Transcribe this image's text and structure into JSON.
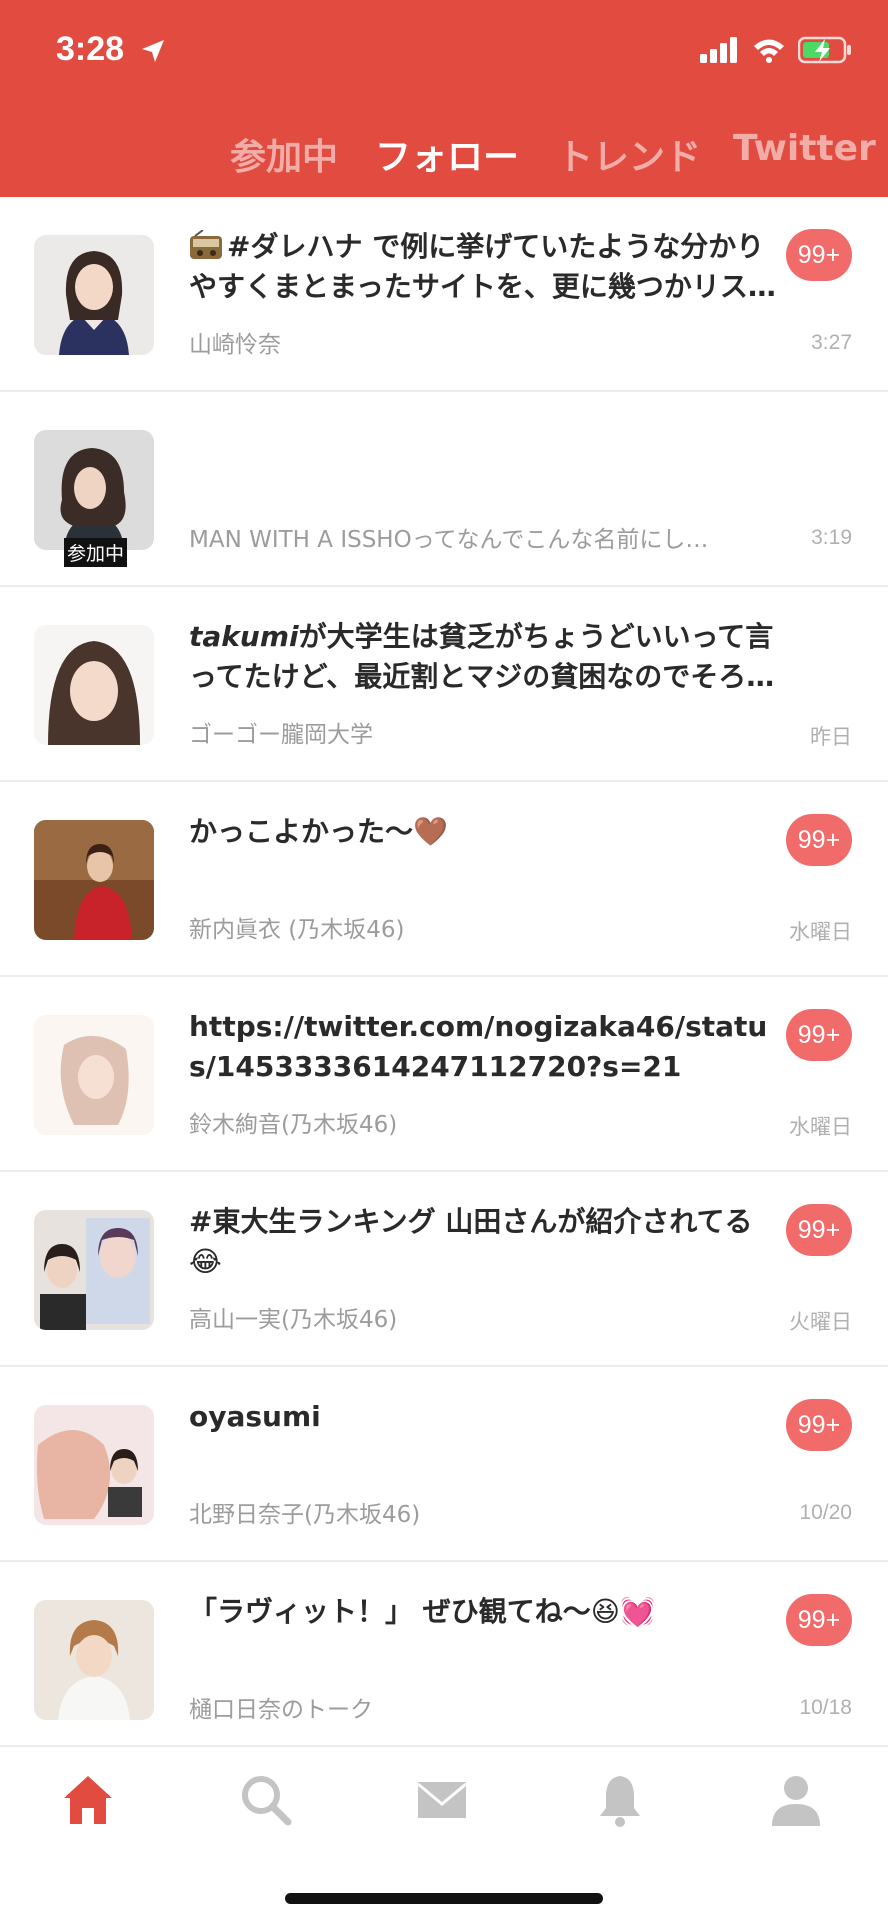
{
  "status_bar": {
    "time": "3:28"
  },
  "header": {
    "tabs": [
      {
        "label": "参加中"
      },
      {
        "label": "フォロー"
      },
      {
        "label": "トレンド"
      },
      {
        "label": "Twitter"
      }
    ],
    "active_tab": "フォロー"
  },
  "rows": [
    {
      "msg_icon": "radio-emoji",
      "message": "#ダレハナ で例に挙げていたような分かりやすくまとまったサイトを、更に幾つかリス…",
      "name": "山崎怜奈",
      "time": "3:27",
      "badge": "99+"
    },
    {
      "message": "",
      "name": "MAN WITH A ISSHOってなんでこんな名前にし…",
      "time": "3:19",
      "joined_label": "参加中"
    },
    {
      "message_italic": "takumi",
      "message": "が大学生は貧乏がちょうどいいって言ってたけど、最近割とマジの貧困なのでそろ…",
      "name": "ゴーゴー朧岡大学",
      "time": "昨日"
    },
    {
      "message": "かっこよかった〜🤎",
      "name": "新内眞衣 (乃木坂46)",
      "time": "水曜日",
      "badge": "99+"
    },
    {
      "message": "https://twitter.com/nogizaka46/status/1453333614247112720?s=21",
      "name": "鈴木絢音(乃木坂46)",
      "time": "水曜日",
      "badge": "99+"
    },
    {
      "message": "#東大生ランキング 山田さんが紹介されてる😂",
      "name": "高山一実(乃木坂46)",
      "time": "火曜日",
      "badge": "99+"
    },
    {
      "message": "oyasumi",
      "name": "北野日奈子(乃木坂46)",
      "time": "10/20",
      "badge": "99+"
    },
    {
      "message": "「ラヴィット！」 ぜひ観てね〜😆💓",
      "name": "樋口日奈のトーク",
      "time": "10/18",
      "badge": "99+"
    }
  ],
  "tab_bar": {
    "items": [
      {
        "icon": "home-icon",
        "active": true
      },
      {
        "icon": "search-icon"
      },
      {
        "icon": "mail-icon"
      },
      {
        "icon": "bell-icon"
      },
      {
        "icon": "profile-icon"
      }
    ],
    "active_color": "#e24b40",
    "inactive_color": "#c4c4c4"
  },
  "colors": {
    "header": "#e24b40",
    "badge": "#f26b6b"
  }
}
